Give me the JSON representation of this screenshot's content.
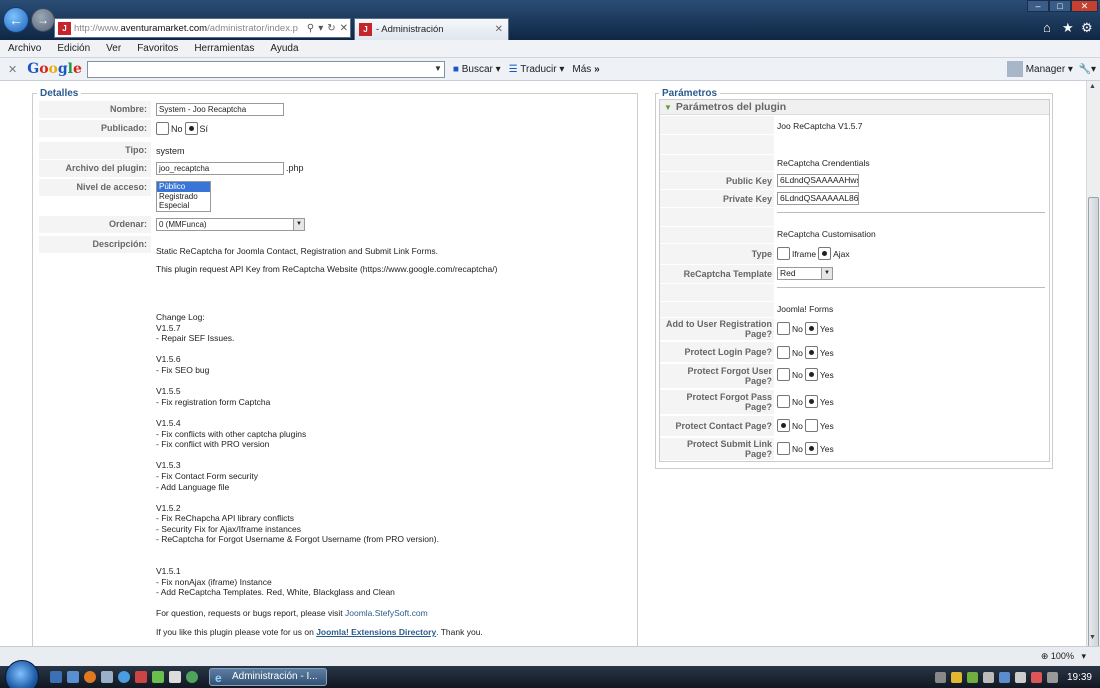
{
  "browser": {
    "url_gray": "http://www.",
    "url_dark": "aventuramarket.com",
    "url_rest": "/administrator/index.p",
    "tab_title": "- Administración",
    "favicon_letter": "J"
  },
  "menu": [
    "Archivo",
    "Edición",
    "Ver",
    "Favoritos",
    "Herramientas",
    "Ayuda"
  ],
  "google_bar": {
    "logo": "Google",
    "search": "Buscar",
    "translate": "Traducir",
    "more": "Más",
    "more_arrow": "»",
    "user": "Manager"
  },
  "detalles": {
    "legend": "Detalles",
    "nombre_label": "Nombre:",
    "nombre_value": "System - Joo Recaptcha",
    "publicado_label": "Publicado:",
    "publicado_no": "No",
    "publicado_si": "Sí",
    "tipo_label": "Tipo:",
    "tipo_value": "system",
    "archivo_label": "Archivo del plugin:",
    "archivo_value": "joo_recaptcha",
    "archivo_ext": ".php",
    "acceso_label": "Nivel de acceso:",
    "acceso_options": [
      "Público",
      "Registrado",
      "Especial"
    ],
    "ordenar_label": "Ordenar:",
    "ordenar_value": "0 (MMFunca)",
    "descripcion_label": "Descripción:",
    "desc_intro": "Static ReCaptcha for Joomla Contact, Registration and Submit Link Forms.",
    "desc_api": "This plugin request API Key from ReCaptcha Website (https://www.google.com/recaptcha/)",
    "changelog": "Change Log:\nV1.5.7\n- Repair SEF Issues.\n\nV1.5.6\n- Fix SEO bug\n\nV1.5.5\n- Fix registration form Captcha\n\nV1.5.4\n- Fix conflicts with other captcha plugins\n- Fix conflict with PRO version\n\nV1.5.3\n- Fix Contact Form security\n- Add Language file\n\nV1.5.2\n- Fix ReChapcha API library conflicts\n- Security Fix for Ajax/Iframe instances\n- ReCaptcha for Forgot Username & Forgot Username (from PRO version).\n\n\nV1.5.1\n- Fix nonAjax (iframe) Instance\n- Add ReCaptcha Templates. Red, White, Blackglass and Clean",
    "question_text": "For question, requests or bugs report, please visit ",
    "question_link": "Joomla.StefySoft.com",
    "vote_text": "If you like this plugin please vote for us on ",
    "vote_link": "Joomla! Extensions Directory",
    "vote_end": ". Thank you."
  },
  "parametros": {
    "legend": "Parámetros",
    "header": "Parámetros del plugin",
    "version": "Joo ReCaptcha V1.5.7",
    "credentials_title": "ReCaptcha Crendentials",
    "public_key_label": "Public Key",
    "public_key_value": "6LdndQSAAAAAHwsY",
    "private_key_label": "Private Key",
    "private_key_value": "6LdndQSAAAAAL86E",
    "customisation_title": "ReCaptcha Customisation",
    "type_label": "Type",
    "type_iframe": "Iframe",
    "type_ajax": "Ajax",
    "template_label": "ReCaptcha Template",
    "template_value": "Red",
    "forms_title": "Joomla! Forms",
    "no": "No",
    "yes": "Yes",
    "q_registration": "Add to User Registration Page?",
    "q_login": "Protect Login Page?",
    "q_forgot_user": "Protect Forgot User Page?",
    "q_forgot_pass": "Protect Forgot Pass Page?",
    "q_contact": "Protect Contact Page?",
    "q_submit_link": "Protect Submit Link Page?"
  },
  "status": {
    "zoom": "100%",
    "zoom_arrow": "▾"
  },
  "taskbar": {
    "task_label": "Administración - I...",
    "clock": "19:39"
  },
  "colors": {
    "accent": "#2b5b8e",
    "selection": "#3875d7",
    "frame": "#0f2744"
  }
}
